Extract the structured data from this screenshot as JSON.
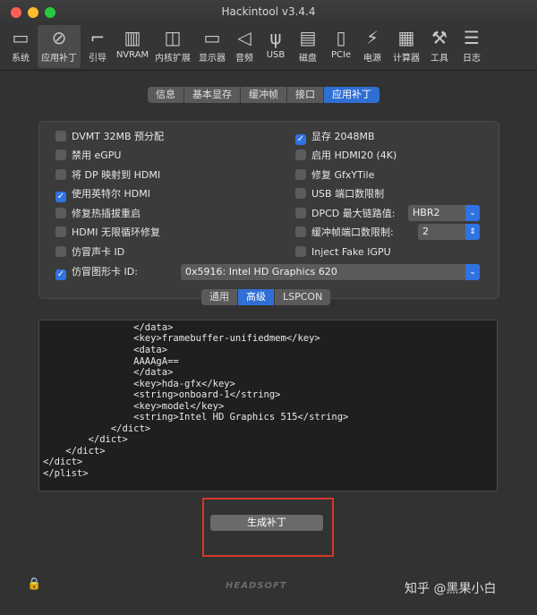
{
  "window": {
    "title": "Hackintool v3.4.4"
  },
  "toolbar": [
    {
      "label": "系统",
      "icon": "computer-icon"
    },
    {
      "label": "应用补丁",
      "icon": "bandage-icon"
    },
    {
      "label": "引导",
      "icon": "boot-icon"
    },
    {
      "label": "NVRAM",
      "icon": "nvram-icon"
    },
    {
      "label": "内核扩展",
      "icon": "lego-icon"
    },
    {
      "label": "显示器",
      "icon": "monitor-icon"
    },
    {
      "label": "音频",
      "icon": "speaker-icon"
    },
    {
      "label": "USB",
      "icon": "usb-icon"
    },
    {
      "label": "磁盘",
      "icon": "disk-icon"
    },
    {
      "label": "PCIe",
      "icon": "pcie-icon"
    },
    {
      "label": "电源",
      "icon": "power-icon"
    },
    {
      "label": "计算器",
      "icon": "calculator-icon"
    },
    {
      "label": "工具",
      "icon": "wrench-icon"
    },
    {
      "label": "日志",
      "icon": "log-icon"
    }
  ],
  "top_tabs": [
    "信息",
    "基本显存",
    "缓冲帧",
    "接口",
    "应用补丁"
  ],
  "left_options": [
    {
      "label": "DVMT 32MB 预分配",
      "checked": false
    },
    {
      "label": "禁用 eGPU",
      "checked": false
    },
    {
      "label": "将 DP 映射到 HDMI",
      "checked": false
    },
    {
      "label": "使用英特尔 HDMI",
      "checked": true
    },
    {
      "label": "修复热插拔重启",
      "checked": false
    },
    {
      "label": "HDMI 无限循环修复",
      "checked": false
    },
    {
      "label": "仿冒声卡 ID",
      "checked": false
    },
    {
      "label": "仿冒图形卡 ID:",
      "checked": true
    }
  ],
  "right_options": [
    {
      "label": "显存 2048MB",
      "checked": true
    },
    {
      "label": "启用 HDMI20 (4K)",
      "checked": false
    },
    {
      "label": "修复 GfxYTile",
      "checked": false
    },
    {
      "label": "USB 端口数限制",
      "checked": false
    },
    {
      "label": "DPCD 最大链路值:",
      "checked": false
    },
    {
      "label": "缓冲帧端口数限制:",
      "checked": false
    },
    {
      "label": "Inject Fake IGPU",
      "checked": false
    }
  ],
  "dpcd_select": "HBR2",
  "port_limit_select": "2",
  "gpu_id_select": "0x5916: Intel HD Graphics 620",
  "bottom_tabs": [
    "通用",
    "高级",
    "LSPCON"
  ],
  "code_lines": [
    "                </data>",
    "                <key>framebuffer-unifiedmem</key>",
    "                <data>",
    "                AAAAgA==",
    "                </data>",
    "                <key>hda-gfx</key>",
    "                <string>onboard-1</string>",
    "                <key>model</key>",
    "                <string>Intel HD Graphics 515</string>",
    "            </dict>",
    "        </dict>",
    "    </dict>",
    "</dict>",
    "</plist>"
  ],
  "generate_button": "生成补丁",
  "brand": "HEADSOFT",
  "watermark": "知乎 @黑果小白",
  "accent": "#2f73e0"
}
